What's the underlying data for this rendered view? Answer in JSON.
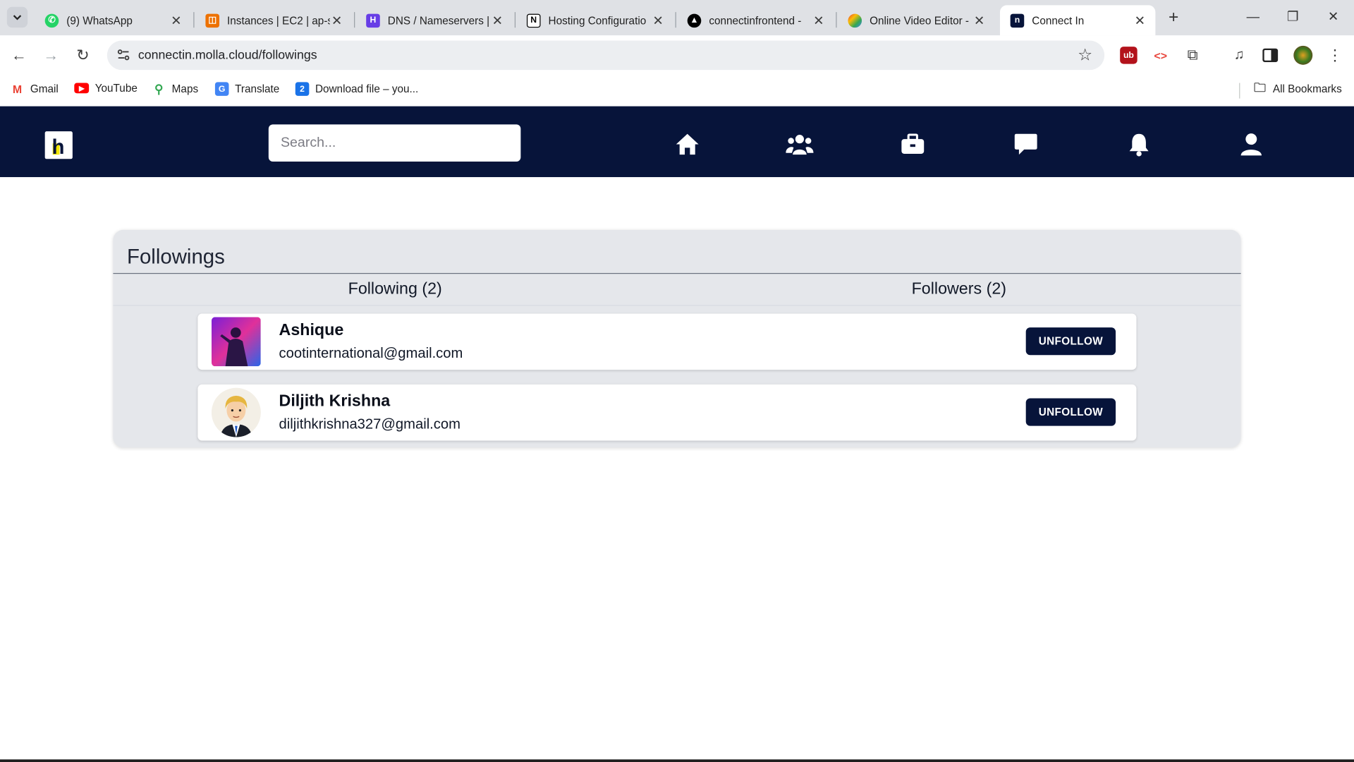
{
  "browser": {
    "tabs": [
      {
        "title": "(9) WhatsApp",
        "icon": "whatsapp-icon",
        "color": "#25d366"
      },
      {
        "title": "Instances | EC2 | ap-s",
        "icon": "aws-ec2-icon",
        "color": "#ed7100"
      },
      {
        "title": "DNS / Nameservers |",
        "icon": "hostinger-icon",
        "color": "#673de6"
      },
      {
        "title": "Hosting Configuratio",
        "icon": "notion-icon",
        "color": "#000000"
      },
      {
        "title": "connectinfrontend - ",
        "icon": "vercel-icon",
        "color": "#000000"
      },
      {
        "title": "Online Video Editor - ",
        "icon": "video-editor-icon",
        "color": "#4285f4"
      },
      {
        "title": "Connect In",
        "icon": "connectin-icon",
        "color": "#07143a",
        "active": true
      }
    ],
    "address": "connectin.molla.cloud/followings",
    "bookmarks": [
      {
        "label": "Gmail",
        "icon": "gmail-icon"
      },
      {
        "label": "YouTube",
        "icon": "youtube-icon"
      },
      {
        "label": "Maps",
        "icon": "maps-icon"
      },
      {
        "label": "Translate",
        "icon": "translate-icon"
      },
      {
        "label": "Download file – you...",
        "icon": "download-icon"
      }
    ],
    "all_bookmarks_label": "All Bookmarks"
  },
  "site": {
    "search_placeholder": "Search...",
    "nav_icons": [
      "home-icon",
      "network-icon",
      "jobs-icon",
      "messages-icon",
      "notifications-icon",
      "profile-icon"
    ],
    "brand_color": "#07143a"
  },
  "followings": {
    "title": "Followings",
    "tabs": [
      {
        "label": "Following (2)"
      },
      {
        "label": "Followers (2)"
      }
    ],
    "users": [
      {
        "name": "Ashique",
        "email": "cootinternational@gmail.com",
        "button": "UNFOLLOW"
      },
      {
        "name": "Diljith Krishna",
        "email": "diljithkrishna327@gmail.com",
        "button": "UNFOLLOW"
      }
    ]
  }
}
